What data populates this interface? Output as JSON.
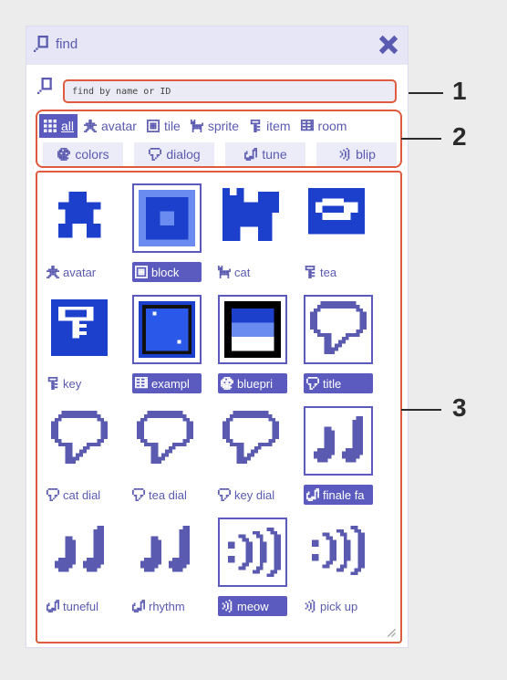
{
  "window": {
    "title": "find",
    "title_icon": "magnifier-icon",
    "close_icon": "close-icon"
  },
  "search": {
    "placeholder": "find by name or ID",
    "value": ""
  },
  "filters": {
    "row1": [
      {
        "label": "all",
        "icon": "grid-icon",
        "active": true
      },
      {
        "label": "avatar",
        "icon": "avatar-icon"
      },
      {
        "label": "tile",
        "icon": "tile-icon"
      },
      {
        "label": "sprite",
        "icon": "sprite-icon"
      },
      {
        "label": "item",
        "icon": "item-icon"
      },
      {
        "label": "room",
        "icon": "room-icon"
      }
    ],
    "row2": [
      {
        "label": "colors",
        "icon": "palette-icon"
      },
      {
        "label": "dialog",
        "icon": "dialog-icon"
      },
      {
        "label": "tune",
        "icon": "tune-icon"
      },
      {
        "label": "blip",
        "icon": "blip-icon"
      }
    ]
  },
  "items": [
    {
      "label": "avatar",
      "kind": "avatar",
      "selected": false
    },
    {
      "label": "block",
      "kind": "tile",
      "selected": true
    },
    {
      "label": "cat",
      "kind": "sprite",
      "selected": false
    },
    {
      "label": "tea",
      "kind": "item",
      "selected": false
    },
    {
      "label": "key",
      "kind": "item",
      "selected": false
    },
    {
      "label": "exampl",
      "kind": "room",
      "selected": true
    },
    {
      "label": "bluepri",
      "kind": "palette",
      "selected": true
    },
    {
      "label": "title",
      "kind": "dialog",
      "selected": true
    },
    {
      "label": "cat dial",
      "kind": "dialog",
      "selected": false
    },
    {
      "label": "tea dial",
      "kind": "dialog",
      "selected": false
    },
    {
      "label": "key dial",
      "kind": "dialog",
      "selected": false
    },
    {
      "label": "finale fa",
      "kind": "tune",
      "selected": true
    },
    {
      "label": "tuneful",
      "kind": "tune",
      "selected": false
    },
    {
      "label": "rhythm",
      "kind": "tune",
      "selected": false
    },
    {
      "label": "meow",
      "kind": "blip",
      "selected": true
    },
    {
      "label": "pick up",
      "kind": "blip",
      "selected": false
    }
  ],
  "callouts": [
    "1",
    "2",
    "3"
  ],
  "colors": {
    "accent": "#5b5bbf",
    "sprite_blue": "#1c40cc",
    "highlight": "#e05a3e"
  }
}
